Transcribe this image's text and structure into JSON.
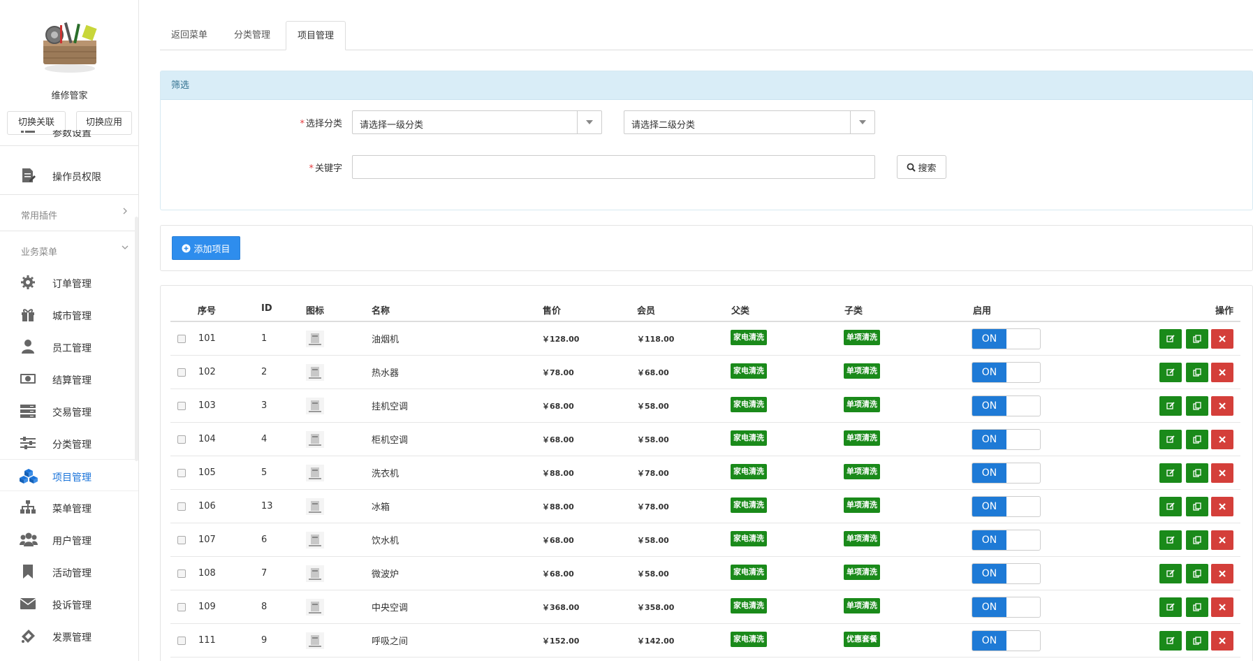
{
  "sidebar": {
    "app_name": "维修管家",
    "switch_link_label": "切换关联",
    "switch_app_label": "切换应用",
    "items_top": [
      {
        "label": "参数设置",
        "icon": "list-icon"
      },
      {
        "label": "操作员权限",
        "icon": "document-edit-icon"
      }
    ],
    "section_plugins": "常用插件",
    "section_business": "业务菜单",
    "items": [
      {
        "label": "订单管理",
        "icon": "gear-icon"
      },
      {
        "label": "城市管理",
        "icon": "gift-icon"
      },
      {
        "label": "员工管理",
        "icon": "user-icon"
      },
      {
        "label": "结算管理",
        "icon": "money-icon"
      },
      {
        "label": "交易管理",
        "icon": "server-icon"
      },
      {
        "label": "分类管理",
        "icon": "sliders-icon"
      },
      {
        "label": "项目管理",
        "icon": "cubes-icon"
      },
      {
        "label": "菜单管理",
        "icon": "sitemap-icon"
      },
      {
        "label": "用户管理",
        "icon": "users-icon"
      },
      {
        "label": "活动管理",
        "icon": "bookmark-icon"
      },
      {
        "label": "投诉管理",
        "icon": "envelope-icon"
      },
      {
        "label": "发票管理",
        "icon": "ticket-icon"
      }
    ],
    "active_item": "项目管理",
    "accent_color": "#1a73d9"
  },
  "tabs": [
    {
      "label": "返回菜单"
    },
    {
      "label": "分类管理"
    },
    {
      "label": "项目管理",
      "active": true
    }
  ],
  "filter": {
    "title": "筛选",
    "category_label": "选择分类",
    "primary_select": "请选择一级分类",
    "secondary_select": "请选择二级分类",
    "keyword_label": "关键字",
    "keyword_value": "",
    "search_label": "搜索"
  },
  "add_button_label": "添加项目",
  "table": {
    "headers": {
      "seq": "序号",
      "id": "ID",
      "icon": "图标",
      "name": "名称",
      "price": "售价",
      "member": "会员",
      "parent": "父类",
      "child": "子类",
      "enabled": "启用",
      "actions": "操作"
    },
    "toggle_label": "ON",
    "rows": [
      {
        "seq": "101",
        "id": "1",
        "name": "油烟机",
        "price": "￥128.00",
        "member": "￥118.00",
        "parent": "家电清洗",
        "child": "单项清洗"
      },
      {
        "seq": "102",
        "id": "2",
        "name": "热水器",
        "price": "￥78.00",
        "member": "￥68.00",
        "parent": "家电清洗",
        "child": "单项清洗"
      },
      {
        "seq": "103",
        "id": "3",
        "name": "挂机空调",
        "price": "￥68.00",
        "member": "￥58.00",
        "parent": "家电清洗",
        "child": "单项清洗"
      },
      {
        "seq": "104",
        "id": "4",
        "name": "柜机空调",
        "price": "￥68.00",
        "member": "￥58.00",
        "parent": "家电清洗",
        "child": "单项清洗"
      },
      {
        "seq": "105",
        "id": "5",
        "name": "洗衣机",
        "price": "￥88.00",
        "member": "￥78.00",
        "parent": "家电清洗",
        "child": "单项清洗"
      },
      {
        "seq": "106",
        "id": "13",
        "name": "冰箱",
        "price": "￥88.00",
        "member": "￥78.00",
        "parent": "家电清洗",
        "child": "单项清洗"
      },
      {
        "seq": "107",
        "id": "6",
        "name": "饮水机",
        "price": "￥68.00",
        "member": "￥58.00",
        "parent": "家电清洗",
        "child": "单项清洗"
      },
      {
        "seq": "108",
        "id": "7",
        "name": "微波炉",
        "price": "￥68.00",
        "member": "￥58.00",
        "parent": "家电清洗",
        "child": "单项清洗"
      },
      {
        "seq": "109",
        "id": "8",
        "name": "中央空调",
        "price": "￥368.00",
        "member": "￥358.00",
        "parent": "家电清洗",
        "child": "单项清洗"
      },
      {
        "seq": "111",
        "id": "9",
        "name": "呼吸之间",
        "price": "￥152.00",
        "member": "￥142.00",
        "parent": "家电清洗",
        "child": "优惠套餐"
      }
    ]
  },
  "colors": {
    "tag_green": "#1a8a1a",
    "toggle_blue": "#1e7ad6",
    "delete_red": "#d43f3a",
    "add_blue": "#2e8ded",
    "panel_head_bg": "#d9edf7"
  }
}
